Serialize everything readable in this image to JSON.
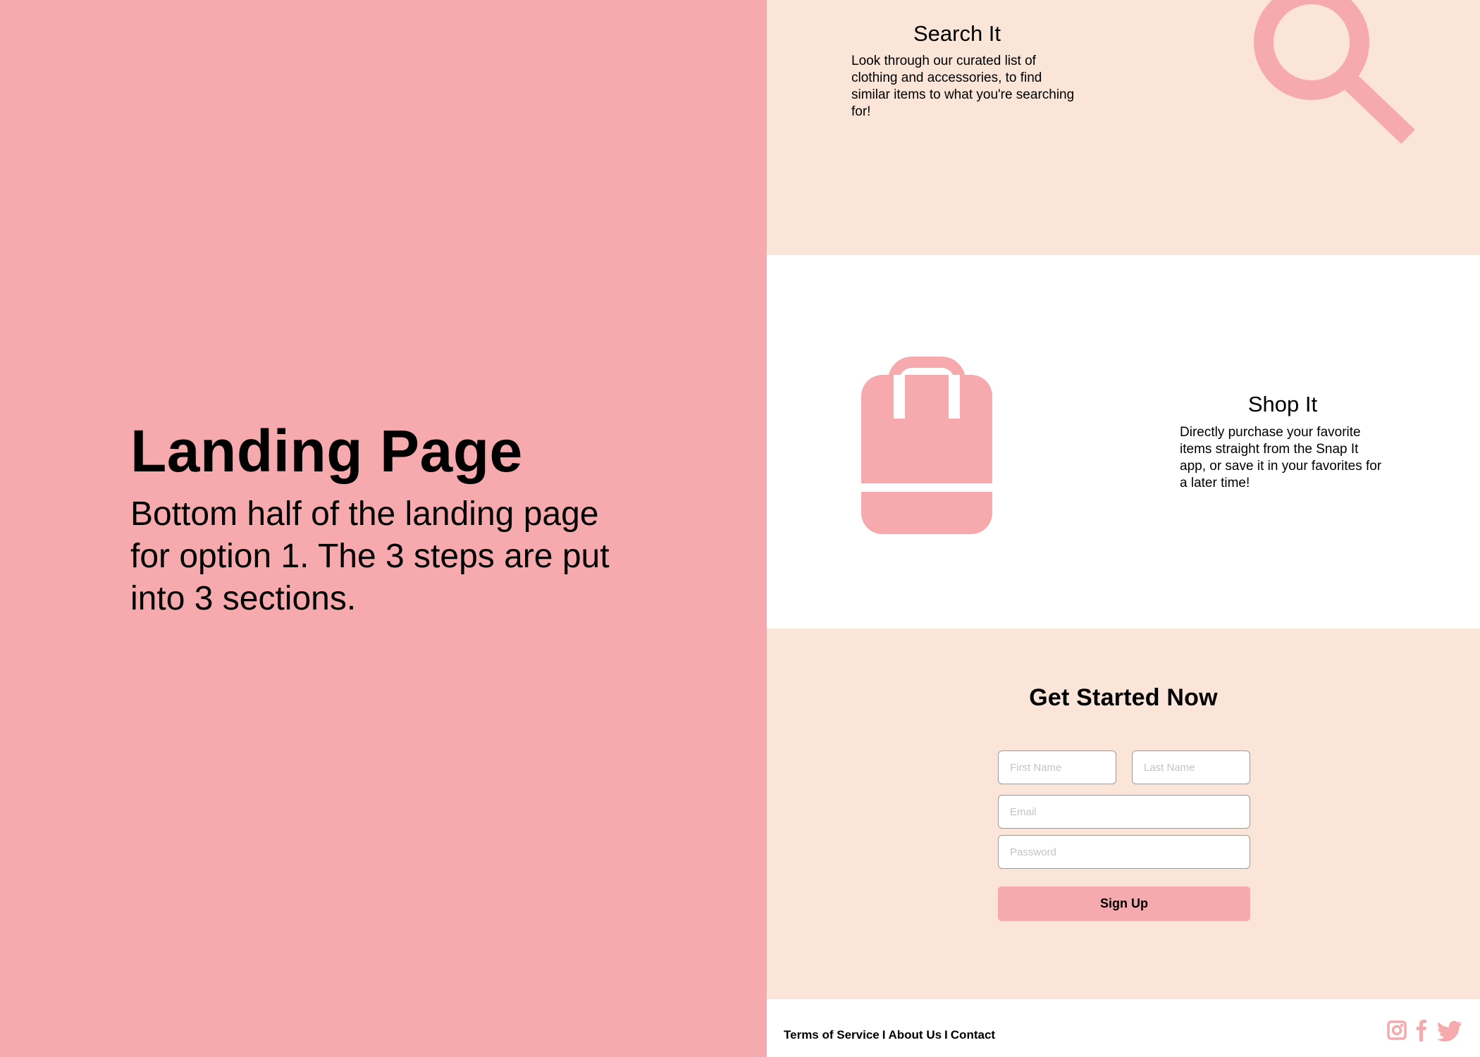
{
  "left": {
    "title": "Landing Page",
    "description": "Bottom half of the landing page for option 1. The 3 steps are put into 3 sections."
  },
  "search_section": {
    "title": "Search It",
    "text": "Look through our curated list of clothing and accessories, to find similar items to what you're searching for!",
    "icon": "search-icon"
  },
  "shop_section": {
    "title": "Shop It",
    "text": "Directly purchase your favorite items straight from the Snap It app, or save it in your favorites for a later time!",
    "icon": "shopping-bag-icon"
  },
  "signup_section": {
    "title": "Get Started Now",
    "first_name_placeholder": "First Name",
    "last_name_placeholder": "Last Name",
    "email_placeholder": "Email",
    "password_placeholder": "Password",
    "button_label": "Sign Up"
  },
  "footer": {
    "links": [
      "Terms of Service",
      "About Us",
      "Contact"
    ],
    "separator": "I",
    "social_icons": [
      "instagram-icon",
      "facebook-icon",
      "twitter-icon"
    ]
  },
  "colors": {
    "accent_pink": "#f6aaad",
    "peach": "#fbe5d8",
    "white": "#ffffff"
  }
}
